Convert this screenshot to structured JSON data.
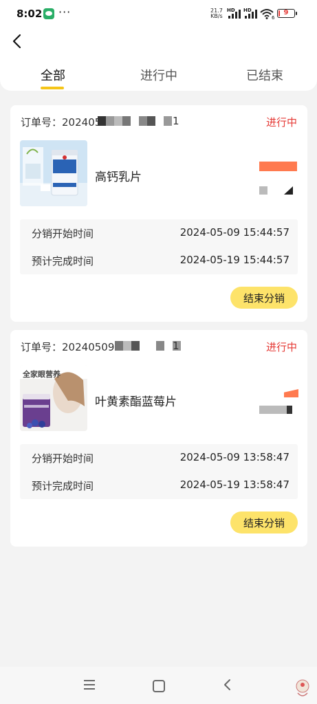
{
  "statusbar": {
    "time": "8:02",
    "more": "···",
    "speed_value": "21.7",
    "speed_unit": "KB/s",
    "hd1": "HD",
    "hd2": "HD",
    "battery": "9",
    "battery_level": 0.09,
    "wifi_sub": "6"
  },
  "tabs": [
    {
      "label": "全部",
      "active": true
    },
    {
      "label": "进行中",
      "active": false
    },
    {
      "label": "已结束",
      "active": false
    }
  ],
  "orders": [
    {
      "order_label": "订单号：",
      "order_no_visible": "202405",
      "order_no_tail": "1",
      "status": "进行中",
      "product_name": "高钙乳片",
      "start_label": "分销开始时间",
      "start_time": "2024-05-09 15:44:57",
      "end_label": "预计完成时间",
      "end_time": "2024-05-19 15:44:57",
      "button": "结束分销"
    },
    {
      "order_label": "订单号：",
      "order_no_visible": "20240509135",
      "order_no_tail": "1",
      "status": "进行中",
      "product_name": "叶黄素酯蓝莓片",
      "thumb_title": "全家眼营养",
      "start_label": "分销开始时间",
      "start_time": "2024-05-09 13:58:47",
      "end_label": "预计完成时间",
      "end_time": "2024-05-19 13:58:47",
      "button": "结束分销"
    }
  ],
  "colors": {
    "accent": "#f5c518",
    "button_bg": "#fde36a",
    "status_red": "#e53935",
    "page_bg": "#f3f3f3"
  },
  "icons": {
    "back": "back-arrow-icon",
    "nav_menu": "menu-icon",
    "nav_home": "home-icon",
    "nav_back": "back-icon"
  }
}
